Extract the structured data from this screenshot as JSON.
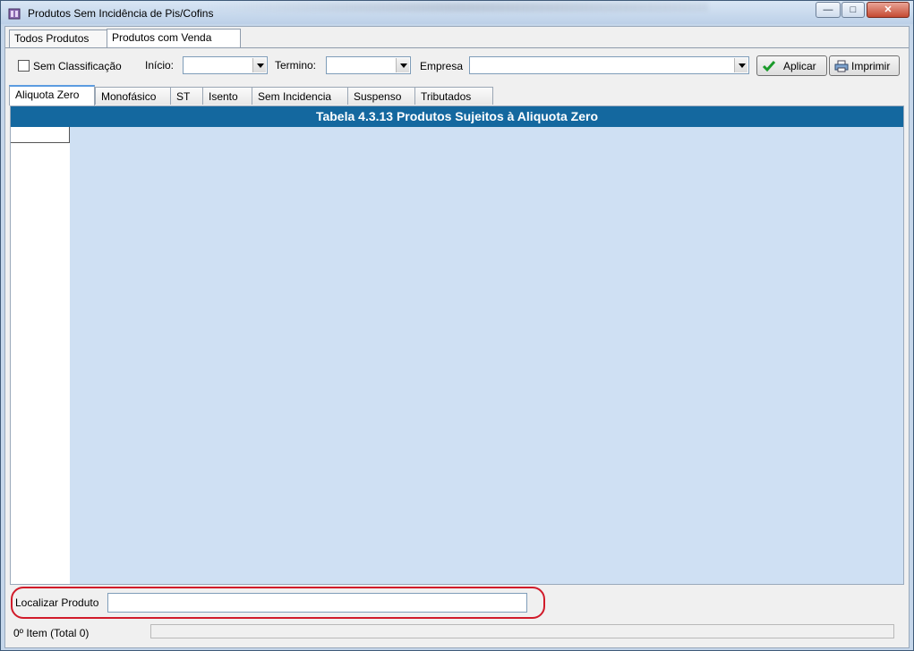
{
  "window": {
    "title": "Produtos Sem Incidência de Pis/Cofins",
    "controls": {
      "minimize": "—",
      "maximize": "□",
      "close": "✕"
    }
  },
  "tabs": [
    {
      "label": "Todos Produtos",
      "selected": false
    },
    {
      "label": "Produtos com Venda",
      "selected": true
    }
  ],
  "filters": {
    "sem_classificacao_label": "Sem Classificação",
    "sem_classificacao_checked": false,
    "inicio_label": "Início:",
    "inicio_value": "",
    "termino_label": "Termino:",
    "termino_value": "",
    "empresa_label": "Empresa",
    "empresa_value": "",
    "aplicar_label": "Aplicar",
    "imprimir_label": "Imprimir"
  },
  "subtabs": [
    {
      "label": "Aliquota Zero",
      "selected": true
    },
    {
      "label": "Monofásico",
      "selected": false
    },
    {
      "label": "ST",
      "selected": false
    },
    {
      "label": "Isento",
      "selected": false
    },
    {
      "label": "Sem Incidencia",
      "selected": false
    },
    {
      "label": "Suspenso",
      "selected": false
    },
    {
      "label": "Tributados",
      "selected": false
    }
  ],
  "grid": {
    "header": "Tabela 4.3.13 Produtos Sujeitos à Aliquota Zero"
  },
  "search": {
    "label": "Localizar Produto",
    "value": ""
  },
  "status": {
    "text": "0º Item (Total 0)"
  },
  "colors": {
    "grid_header_bg": "#14689f",
    "grid_bg": "#cfe0f3",
    "highlight": "#d11b2a",
    "check_icon": "#1a9a2a"
  }
}
